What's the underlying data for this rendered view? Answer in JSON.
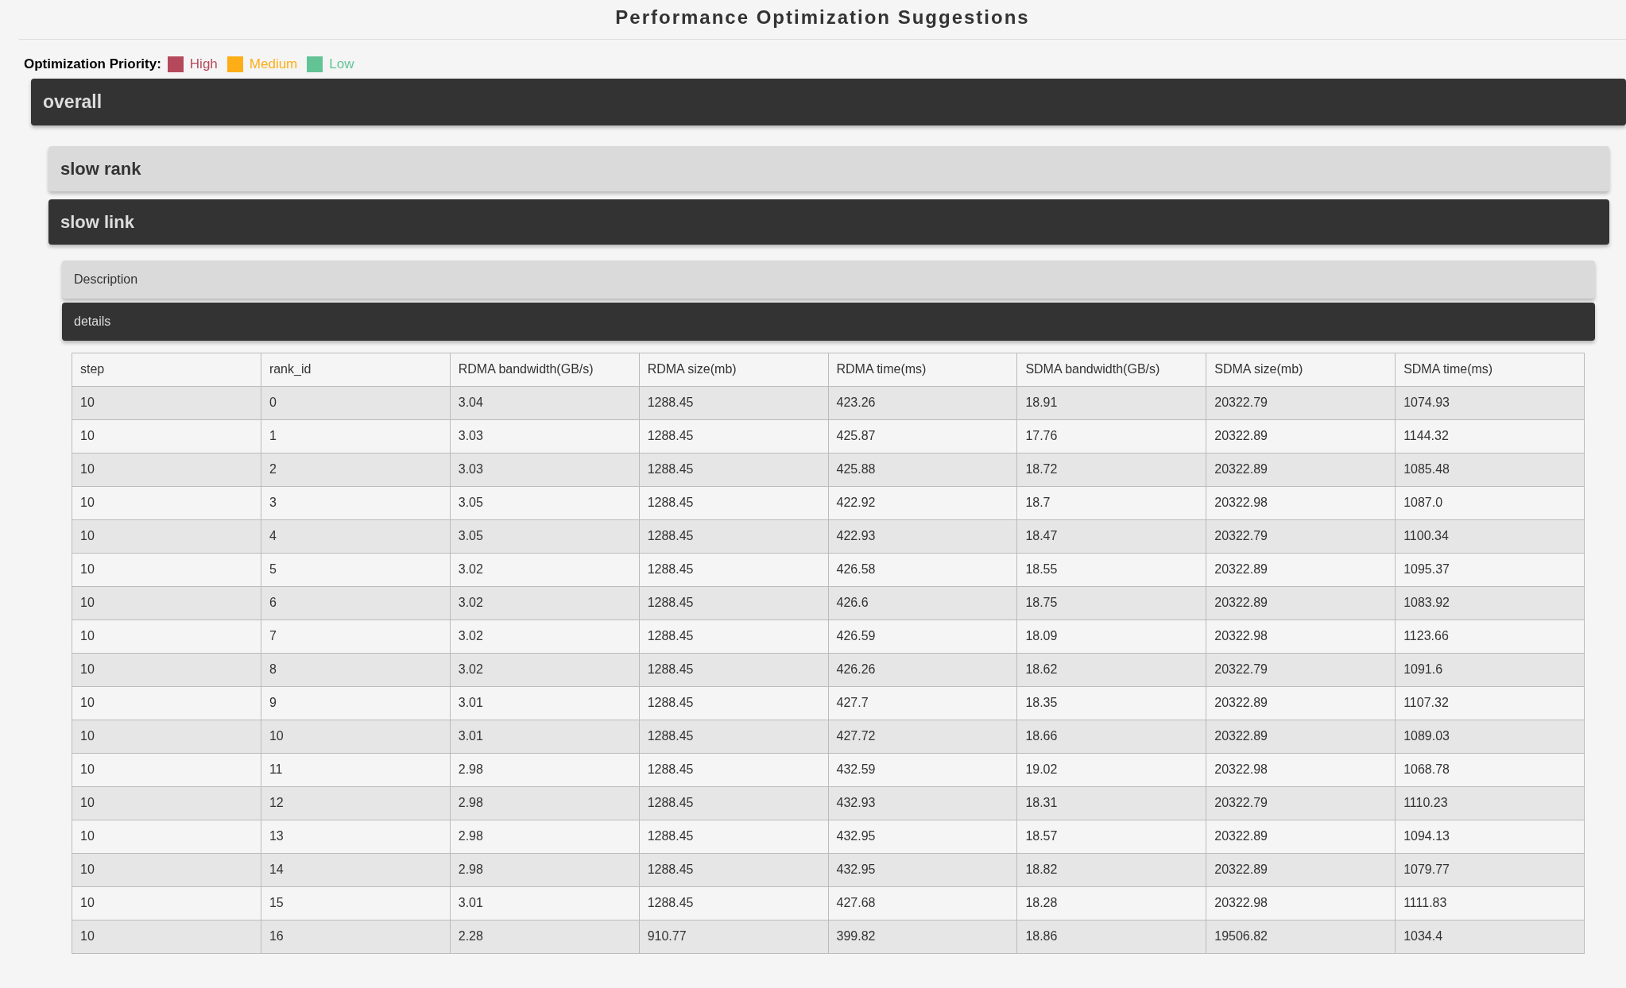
{
  "title": "Performance Optimization Suggestions",
  "legend": {
    "label": "Optimization Priority:",
    "items": [
      {
        "label": "High",
        "color": "#b5495b"
      },
      {
        "label": "Medium",
        "color": "#fdae16"
      },
      {
        "label": "Low",
        "color": "#62c395"
      }
    ]
  },
  "sections": [
    {
      "title": "overall",
      "expanded": true,
      "children": [
        {
          "title": "slow rank",
          "expanded": false
        },
        {
          "title": "slow link",
          "expanded": true,
          "children": [
            {
              "title": "Description",
              "expanded": false
            },
            {
              "title": "details",
              "expanded": true,
              "table": {
                "columns": [
                  "step",
                  "rank_id",
                  "RDMA bandwidth(GB/s)",
                  "RDMA size(mb)",
                  "RDMA time(ms)",
                  "SDMA bandwidth(GB/s)",
                  "SDMA size(mb)",
                  "SDMA time(ms)"
                ],
                "rows": [
                  [
                    "10",
                    "0",
                    "3.04",
                    "1288.45",
                    "423.26",
                    "18.91",
                    "20322.79",
                    "1074.93"
                  ],
                  [
                    "10",
                    "1",
                    "3.03",
                    "1288.45",
                    "425.87",
                    "17.76",
                    "20322.89",
                    "1144.32"
                  ],
                  [
                    "10",
                    "2",
                    "3.03",
                    "1288.45",
                    "425.88",
                    "18.72",
                    "20322.89",
                    "1085.48"
                  ],
                  [
                    "10",
                    "3",
                    "3.05",
                    "1288.45",
                    "422.92",
                    "18.7",
                    "20322.98",
                    "1087.0"
                  ],
                  [
                    "10",
                    "4",
                    "3.05",
                    "1288.45",
                    "422.93",
                    "18.47",
                    "20322.79",
                    "1100.34"
                  ],
                  [
                    "10",
                    "5",
                    "3.02",
                    "1288.45",
                    "426.58",
                    "18.55",
                    "20322.89",
                    "1095.37"
                  ],
                  [
                    "10",
                    "6",
                    "3.02",
                    "1288.45",
                    "426.6",
                    "18.75",
                    "20322.89",
                    "1083.92"
                  ],
                  [
                    "10",
                    "7",
                    "3.02",
                    "1288.45",
                    "426.59",
                    "18.09",
                    "20322.98",
                    "1123.66"
                  ],
                  [
                    "10",
                    "8",
                    "3.02",
                    "1288.45",
                    "426.26",
                    "18.62",
                    "20322.79",
                    "1091.6"
                  ],
                  [
                    "10",
                    "9",
                    "3.01",
                    "1288.45",
                    "427.7",
                    "18.35",
                    "20322.89",
                    "1107.32"
                  ],
                  [
                    "10",
                    "10",
                    "3.01",
                    "1288.45",
                    "427.72",
                    "18.66",
                    "20322.89",
                    "1089.03"
                  ],
                  [
                    "10",
                    "11",
                    "2.98",
                    "1288.45",
                    "432.59",
                    "19.02",
                    "20322.98",
                    "1068.78"
                  ],
                  [
                    "10",
                    "12",
                    "2.98",
                    "1288.45",
                    "432.93",
                    "18.31",
                    "20322.79",
                    "1110.23"
                  ],
                  [
                    "10",
                    "13",
                    "2.98",
                    "1288.45",
                    "432.95",
                    "18.57",
                    "20322.89",
                    "1094.13"
                  ],
                  [
                    "10",
                    "14",
                    "2.98",
                    "1288.45",
                    "432.95",
                    "18.82",
                    "20322.89",
                    "1079.77"
                  ],
                  [
                    "10",
                    "15",
                    "3.01",
                    "1288.45",
                    "427.68",
                    "18.28",
                    "20322.98",
                    "1111.83"
                  ],
                  [
                    "10",
                    "16",
                    "2.28",
                    "910.77",
                    "399.82",
                    "18.86",
                    "19506.82",
                    "1034.4"
                  ]
                ]
              }
            }
          ]
        }
      ]
    }
  ]
}
